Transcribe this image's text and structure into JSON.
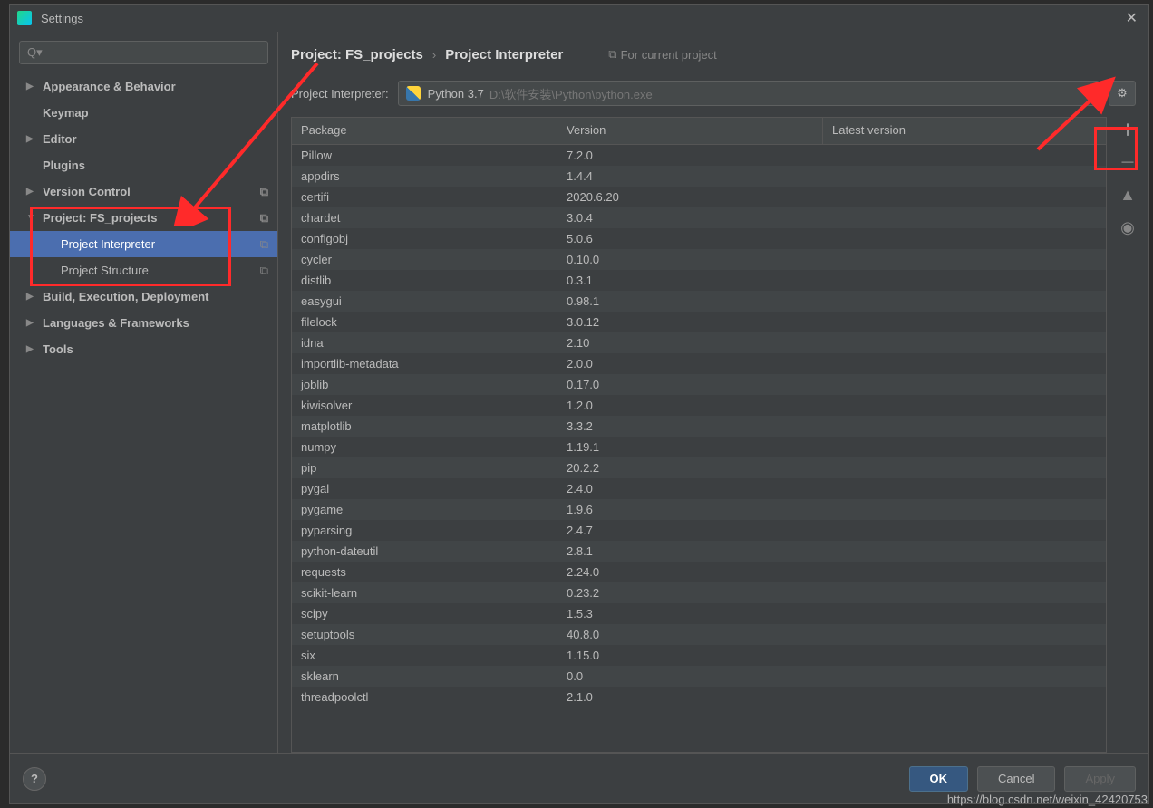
{
  "window": {
    "title": "Settings"
  },
  "search": {
    "placeholder": ""
  },
  "sidebar": {
    "items": [
      {
        "label": "Appearance & Behavior",
        "arrow": "▶",
        "bold": true
      },
      {
        "label": "Keymap",
        "arrow": "",
        "bold": true
      },
      {
        "label": "Editor",
        "arrow": "▶",
        "bold": true
      },
      {
        "label": "Plugins",
        "arrow": "",
        "bold": true
      },
      {
        "label": "Version Control",
        "arrow": "▶",
        "bold": true,
        "copy": true
      },
      {
        "label": "Project: FS_projects",
        "arrow": "▼",
        "bold": true,
        "copy": true
      },
      {
        "label": "Project Interpreter",
        "arrow": "",
        "child": true,
        "selected": true,
        "copy": true
      },
      {
        "label": "Project Structure",
        "arrow": "",
        "child": true,
        "copy": true
      },
      {
        "label": "Build, Execution, Deployment",
        "arrow": "▶",
        "bold": true
      },
      {
        "label": "Languages & Frameworks",
        "arrow": "▶",
        "bold": true
      },
      {
        "label": "Tools",
        "arrow": "▶",
        "bold": true
      }
    ]
  },
  "breadcrumb": {
    "crumb1": "Project: FS_projects",
    "sep": "›",
    "crumb2": "Project Interpreter",
    "hint": "For current project"
  },
  "interpreter": {
    "label": "Project Interpreter:",
    "name": "Python 3.7",
    "path": "D:\\软件安装\\Python\\python.exe"
  },
  "table": {
    "headers": {
      "c1": "Package",
      "c2": "Version",
      "c3": "Latest version"
    },
    "rows": [
      {
        "pkg": "Pillow",
        "ver": "7.2.0"
      },
      {
        "pkg": "appdirs",
        "ver": "1.4.4"
      },
      {
        "pkg": "certifi",
        "ver": "2020.6.20"
      },
      {
        "pkg": "chardet",
        "ver": "3.0.4"
      },
      {
        "pkg": "configobj",
        "ver": "5.0.6"
      },
      {
        "pkg": "cycler",
        "ver": "0.10.0"
      },
      {
        "pkg": "distlib",
        "ver": "0.3.1"
      },
      {
        "pkg": "easygui",
        "ver": "0.98.1"
      },
      {
        "pkg": "filelock",
        "ver": "3.0.12"
      },
      {
        "pkg": "idna",
        "ver": "2.10"
      },
      {
        "pkg": "importlib-metadata",
        "ver": "2.0.0"
      },
      {
        "pkg": "joblib",
        "ver": "0.17.0"
      },
      {
        "pkg": "kiwisolver",
        "ver": "1.2.0"
      },
      {
        "pkg": "matplotlib",
        "ver": "3.3.2"
      },
      {
        "pkg": "numpy",
        "ver": "1.19.1"
      },
      {
        "pkg": "pip",
        "ver": "20.2.2"
      },
      {
        "pkg": "pygal",
        "ver": "2.4.0"
      },
      {
        "pkg": "pygame",
        "ver": "1.9.6"
      },
      {
        "pkg": "pyparsing",
        "ver": "2.4.7"
      },
      {
        "pkg": "python-dateutil",
        "ver": "2.8.1"
      },
      {
        "pkg": "requests",
        "ver": "2.24.0"
      },
      {
        "pkg": "scikit-learn",
        "ver": "0.23.2"
      },
      {
        "pkg": "scipy",
        "ver": "1.5.3"
      },
      {
        "pkg": "setuptools",
        "ver": "40.8.0"
      },
      {
        "pkg": "six",
        "ver": "1.15.0"
      },
      {
        "pkg": "sklearn",
        "ver": "0.0"
      },
      {
        "pkg": "threadpoolctl",
        "ver": "2.1.0"
      }
    ]
  },
  "footer": {
    "ok": "OK",
    "cancel": "Cancel",
    "apply": "Apply"
  },
  "watermark": "https://blog.csdn.net/weixin_42420753"
}
